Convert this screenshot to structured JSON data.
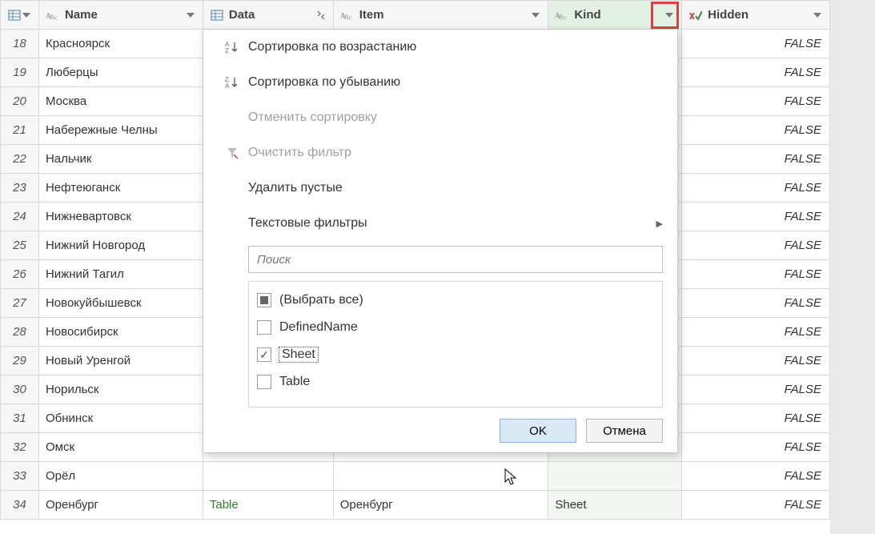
{
  "columns": {
    "row_index": "",
    "name": "Name",
    "data": "Data",
    "item": "Item",
    "kind": "Kind",
    "hidden": "Hidden"
  },
  "rows": [
    {
      "n": "18",
      "name": "Красноярск",
      "hidden": "FALSE"
    },
    {
      "n": "19",
      "name": "Люберцы",
      "hidden": "FALSE"
    },
    {
      "n": "20",
      "name": "Москва",
      "hidden": "FALSE"
    },
    {
      "n": "21",
      "name": "Набережные Челны",
      "hidden": "FALSE"
    },
    {
      "n": "22",
      "name": "Нальчик",
      "hidden": "FALSE"
    },
    {
      "n": "23",
      "name": "Нефтеюганск",
      "hidden": "FALSE"
    },
    {
      "n": "24",
      "name": "Нижневартовск",
      "hidden": "FALSE"
    },
    {
      "n": "25",
      "name": "Нижний Новгород",
      "hidden": "FALSE"
    },
    {
      "n": "26",
      "name": "Нижний Тагил",
      "hidden": "FALSE"
    },
    {
      "n": "27",
      "name": "Новокуйбышевск",
      "hidden": "FALSE"
    },
    {
      "n": "28",
      "name": "Новосибирск",
      "hidden": "FALSE"
    },
    {
      "n": "29",
      "name": "Новый Уренгой",
      "hidden": "FALSE"
    },
    {
      "n": "30",
      "name": "Норильск",
      "hidden": "FALSE"
    },
    {
      "n": "31",
      "name": "Обнинск",
      "hidden": "FALSE"
    },
    {
      "n": "32",
      "name": "Омск",
      "hidden": "FALSE"
    },
    {
      "n": "33",
      "name": "Орёл",
      "hidden": "FALSE"
    },
    {
      "n": "34",
      "name": "Оренбург",
      "data": "Table",
      "item": "Оренбург",
      "kind": "Sheet",
      "hidden": "FALSE"
    }
  ],
  "filter": {
    "sort_asc": "Сортировка по возрастанию",
    "sort_desc": "Сортировка по убыванию",
    "clear_sort": "Отменить сортировку",
    "clear_filter": "Очистить фильтр",
    "remove_empty": "Удалить пустые",
    "text_filters": "Текстовые фильтры",
    "search_placeholder": "Поиск",
    "select_all": "(Выбрать все)",
    "options": [
      {
        "label": "DefinedName",
        "state": "unchecked"
      },
      {
        "label": "Sheet",
        "state": "checked",
        "focused": true
      },
      {
        "label": "Table",
        "state": "unchecked"
      }
    ],
    "ok": "OK",
    "cancel": "Отмена"
  }
}
